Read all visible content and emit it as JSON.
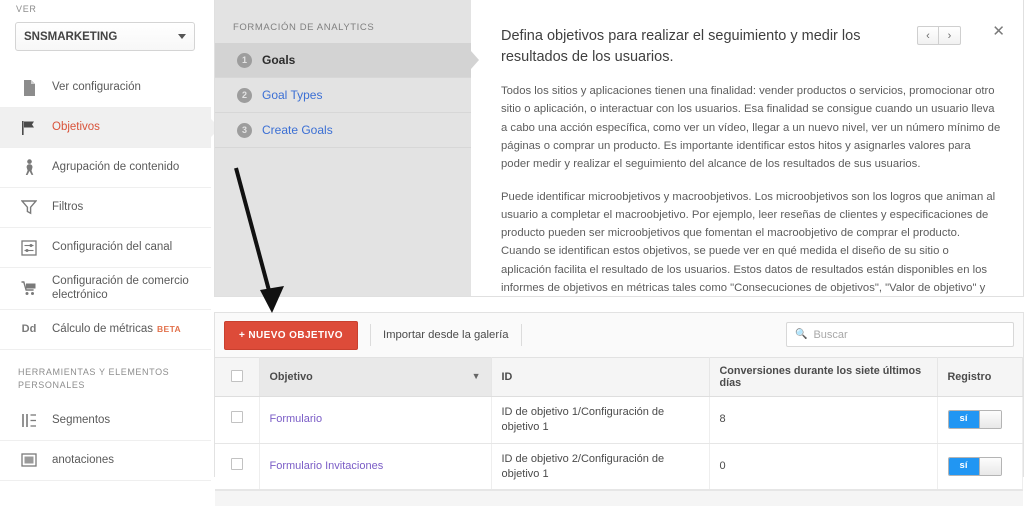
{
  "sidebar": {
    "ver_label": "VER",
    "view_selector": {
      "value": "SNSMARKETING",
      "caret": "chevron-down-icon"
    },
    "items": [
      {
        "label": "Ver configuración",
        "icon": "document-icon",
        "active": false
      },
      {
        "label": "Objetivos",
        "icon": "flag-icon",
        "active": true
      },
      {
        "label": "Agrupación de contenido",
        "icon": "person-icon",
        "active": false
      },
      {
        "label": "Filtros",
        "icon": "funnel-icon",
        "active": false
      },
      {
        "label": "Configuración del canal",
        "icon": "sliders-icon",
        "active": false
      },
      {
        "label": "Configuración de comercio electrónico",
        "icon": "cart-icon",
        "active": false
      },
      {
        "label": "Cálculo de métricas",
        "icon": "dd-icon",
        "badge": "BETA",
        "active": false
      }
    ],
    "section_title": "HERRAMIENTAS Y ELEMENTOS PERSONALES",
    "tools": [
      {
        "label": "Segmentos",
        "icon": "segments-icon"
      },
      {
        "label": "anotaciones",
        "icon": "annotations-icon"
      }
    ]
  },
  "help": {
    "steps_title": "FORMACIÓN DE ANALYTICS",
    "steps": [
      {
        "num": "1",
        "label": "Goals",
        "current": true
      },
      {
        "num": "2",
        "label": "Goal Types",
        "current": false
      },
      {
        "num": "3",
        "label": "Create Goals",
        "current": false
      }
    ],
    "title": "Defina objetivos para realizar el seguimiento y medir los resultados de los usuarios.",
    "paragraph_1": "Todos los sitios y aplicaciones tienen una finalidad: vender productos o servicios, promocionar otro sitio o aplicación, o interactuar con los usuarios. Esa finalidad se consigue cuando un usuario lleva a cabo una acción específica, como ver un vídeo, llegar a un nuevo nivel, ver un número mínimo de páginas o comprar un producto. Es importante identificar estos hitos y asignarles valores para poder medir y realizar el seguimiento del alcance de los resultados de sus usuarios.",
    "paragraph_2": "Puede identificar microobjetivos y macroobjetivos. Los microobjetivos son los logros que animan al usuario a completar el macroobjetivo. Por ejemplo, leer reseñas de clientes y especificaciones de producto pueden ser microobjetivos que fomentan el macroobjetivo de comprar el producto. Cuando se identifican estos objetivos, se puede ver en qué medida el diseño de su sitio o aplicación facilita el resultado de los usuarios. Estos datos de resultados están disponibles en los informes de objetivos en métricas tales como \"Consecuciones de objetivos\", \"Valor de objetivo\" y \"Porcentaje de conversión de objetivos\".",
    "prev_label": "‹",
    "next_label": "›",
    "close_label": "✕"
  },
  "toolbar": {
    "new_goal_label": "+ NUEVO OBJETIVO",
    "import_label": "Importar desde la galería",
    "search_placeholder": "Buscar",
    "search_value": "",
    "search_icon": "search-icon"
  },
  "table": {
    "columns": [
      "Objetivo",
      "ID",
      "Conversiones durante los siete últimos días",
      "Registro"
    ],
    "sort_indicator": "▼",
    "rows": [
      {
        "goal": "Formulario",
        "id": "ID de objetivo 1/Configuración de objetivo 1",
        "conversions": "8",
        "record": "sí"
      },
      {
        "goal": "Formulario Invitaciones",
        "id": "ID de objetivo 2/Configuración de objetivo 1",
        "conversions": "0",
        "record": "sí"
      }
    ]
  },
  "annotation": {
    "arrow": "black-arrow-pointing-to-new-goal-button"
  },
  "colors": {
    "accent_red": "#dd4b39",
    "active_item": "#d9533a",
    "link_blue": "#3b6fd4",
    "goal_link_purple": "#7a5cc6",
    "toggle_blue": "#2196f3"
  }
}
